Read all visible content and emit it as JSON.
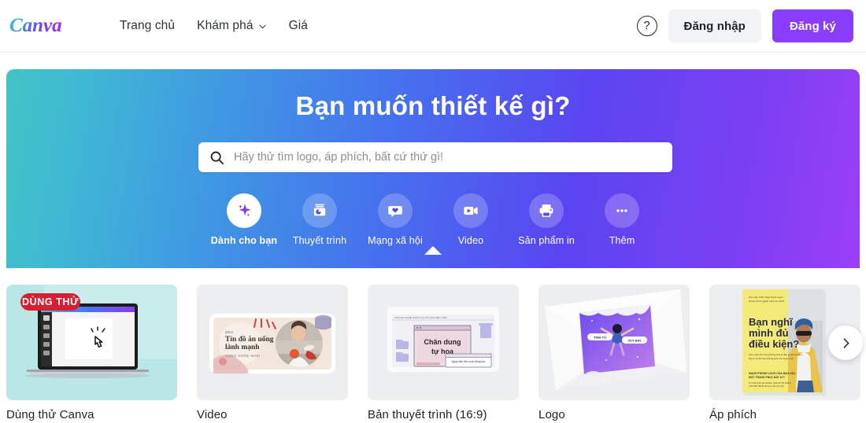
{
  "header": {
    "logo_text": "Canva",
    "nav": [
      {
        "label": "Trang chủ",
        "has_dropdown": false
      },
      {
        "label": "Khám phá",
        "has_dropdown": true
      },
      {
        "label": "Giá",
        "has_dropdown": false
      }
    ],
    "help_label": "?",
    "login_label": "Đăng nhập",
    "signup_label": "Đăng ký"
  },
  "hero": {
    "title": "Bạn muốn thiết kế gì?",
    "search_placeholder": "Hãy thử tìm logo, áp phích, bất cứ thứ gì!",
    "search_value": "",
    "categories": [
      {
        "label": "Dành cho bạn",
        "icon": "sparkle-icon",
        "active": true
      },
      {
        "label": "Thuyết trình",
        "icon": "presentation-chart-icon",
        "active": false
      },
      {
        "label": "Mạng xã hội",
        "icon": "speech-bubble-heart-icon",
        "active": false
      },
      {
        "label": "Video",
        "icon": "video-camera-icon",
        "active": false
      },
      {
        "label": "Sản phẩm in",
        "icon": "printer-icon",
        "active": false
      },
      {
        "label": "Thêm",
        "icon": "more-dots-icon",
        "active": false
      }
    ],
    "gradient_start": "#41c4c4",
    "gradient_end": "#9b3ff5"
  },
  "cards": [
    {
      "label": "Dùng thử Canva",
      "badge": "DÙNG THỬ",
      "badge_color": "#d81f32",
      "thumb_bg": "#b9e7e6",
      "thumb_type": "laptop-editor"
    },
    {
      "label": "Video",
      "thumb_bg": "#eceef0",
      "thumb_type": "video-thumbnail",
      "art_text_small": "MẸO",
      "art_text_line1": "Tín đồ ăn uống",
      "art_text_line2": "lành mạnh",
      "art_text_sub": "CÙNG KHỎE NHÉ!"
    },
    {
      "label": "Bản thuyết trình (16:9)",
      "thumb_bg": "#eceef0",
      "thumb_type": "presentation-desktop",
      "art_header": "LỚP HỌC NGHỆ THUẬT CỦA CÔ GIÁO HIỀN TUẤN",
      "art_title_line1": "Chân dung",
      "art_title_line2": "tự họa",
      "art_note": "Ngày đầu tiên hoạt động lớp"
    },
    {
      "label": "Logo",
      "thumb_bg": "#eceef0",
      "thumb_type": "logo-envelope",
      "art_left_text": "TINH TÚ",
      "art_right_text": "VÚT BAY"
    },
    {
      "label": "Áp phích",
      "thumb_bg": "#eceef0",
      "thumb_type": "poster-yellow",
      "art_top_note": "Học viên Thời trang Hạnh Uyên",
      "art_title_line1": "Bạn nghĩ",
      "art_title_line2": "mình đủ",
      "art_title_line3": "điều kiện?",
      "art_bottom": "MANG PHONG CÁCH CỦA BẠN VÀO MỘT TRANG PHỤC BẤT KỲ!"
    }
  ],
  "carousel": {
    "next_label": "›"
  }
}
